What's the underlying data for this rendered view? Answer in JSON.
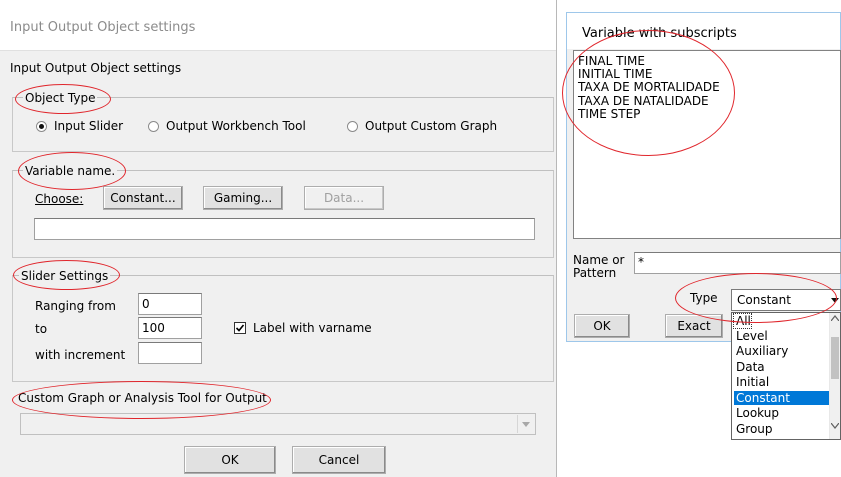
{
  "main_dialog": {
    "window_title": "Input Output Object settings",
    "heading": "Input Output Object settings",
    "object_type": {
      "legend": "Object Type",
      "options": [
        "Input Slider",
        "Output Workbench Tool",
        "Output Custom Graph"
      ],
      "selected": "Input Slider"
    },
    "variable_name": {
      "legend": "Variable name.",
      "choose_label": "Choose:",
      "buttons": {
        "constant": "Constant...",
        "gaming": "Gaming...",
        "data": "Data..."
      },
      "value": ""
    },
    "slider_settings": {
      "legend": "Slider Settings",
      "ranging_from_label": "Ranging from",
      "ranging_from_value": "0",
      "to_label": "to",
      "to_value": "100",
      "increment_label": "with increment",
      "increment_value": "",
      "label_with_varname": "Label with varname",
      "label_with_varname_checked": true
    },
    "custom_graph": {
      "legend": "Custom Graph or Analysis Tool for Output",
      "value": ""
    },
    "ok_label": "OK",
    "cancel_label": "Cancel"
  },
  "subscripts_dialog": {
    "window_title": "Variable with subscripts",
    "variables": [
      "FINAL TIME",
      "INITIAL TIME",
      "TAXA DE MORTALIDADE",
      "TAXA DE NATALIDADE",
      "TIME STEP"
    ],
    "name_label_1": "Name or",
    "name_label_2": "Pattern",
    "pattern_value": "*",
    "type_label": "Type",
    "type_selected": "Constant",
    "type_options": [
      "All",
      "Level",
      "Auxiliary",
      "Data",
      "Initial",
      "Constant",
      "Lookup",
      "Group"
    ],
    "ok_label": "OK",
    "exact_label": "Exact"
  },
  "colors": {
    "annotation_ellipse": "#e0262c",
    "selection": "#0078d7",
    "dialog_background": "#f0f0f0"
  }
}
